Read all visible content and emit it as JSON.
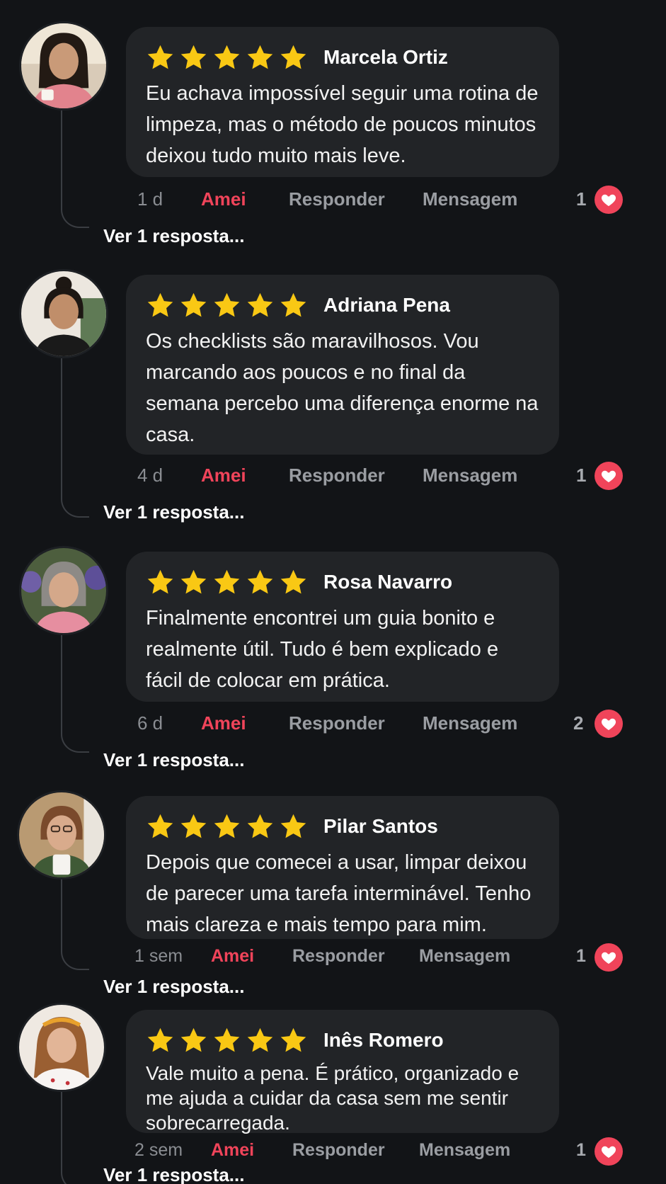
{
  "colors": {
    "background": "#121417",
    "bubble": "#222427",
    "star": "#f9c814",
    "like_accent": "#f0445a",
    "muted_text": "#9a9da2",
    "thread_line": "#3a3d42"
  },
  "icons": {
    "star": "star-icon",
    "heart": "heart-icon"
  },
  "comments": [
    {
      "avatar": "avatar-marcela",
      "rating": 5,
      "name": "Marcela Ortiz",
      "text": "Eu achava impossível seguir uma rotina de limpeza, mas o método de poucos minutos deixou tudo muito mais leve.",
      "time": "1 d",
      "love_label": "Amei",
      "reply_label": "Responder",
      "message_label": "Mensagem",
      "like_count": "1",
      "replies_label": "Ver 1 resposta..."
    },
    {
      "avatar": "avatar-adriana",
      "rating": 5,
      "name": "Adriana Pena",
      "text": "Os checklists são maravilhosos. Vou marcando aos poucos e no final da semana percebo uma diferença enorme na casa.",
      "time": "4 d",
      "love_label": "Amei",
      "reply_label": "Responder",
      "message_label": "Mensagem",
      "like_count": "1",
      "replies_label": "Ver 1 resposta..."
    },
    {
      "avatar": "avatar-rosa",
      "rating": 5,
      "name": "Rosa Navarro",
      "text": "Finalmente encontrei um guia bonito e realmente útil. Tudo é bem explicado e fácil de colocar em prática.",
      "time": "6 d",
      "love_label": "Amei",
      "reply_label": "Responder",
      "message_label": "Mensagem",
      "like_count": "2",
      "replies_label": "Ver 1 resposta..."
    },
    {
      "avatar": "avatar-pilar",
      "rating": 5,
      "name": "Pilar Santos",
      "text": "Depois que comecei a usar, limpar deixou de parecer uma tarefa interminável. Tenho mais clareza e mais tempo para mim.",
      "time": "1 sem",
      "love_label": "Amei",
      "reply_label": "Responder",
      "message_label": "Mensagem",
      "like_count": "1",
      "replies_label": "Ver 1 resposta..."
    },
    {
      "avatar": "avatar-ines",
      "rating": 5,
      "name": "Inês Romero",
      "text": "Vale muito a pena. É prático, organizado e me ajuda a cuidar da casa sem me sentir sobrecarregada.",
      "time": "2 sem",
      "love_label": "Amei",
      "reply_label": "Responder",
      "message_label": "Mensagem",
      "like_count": "1",
      "replies_label": "Ver 1 resposta..."
    }
  ]
}
